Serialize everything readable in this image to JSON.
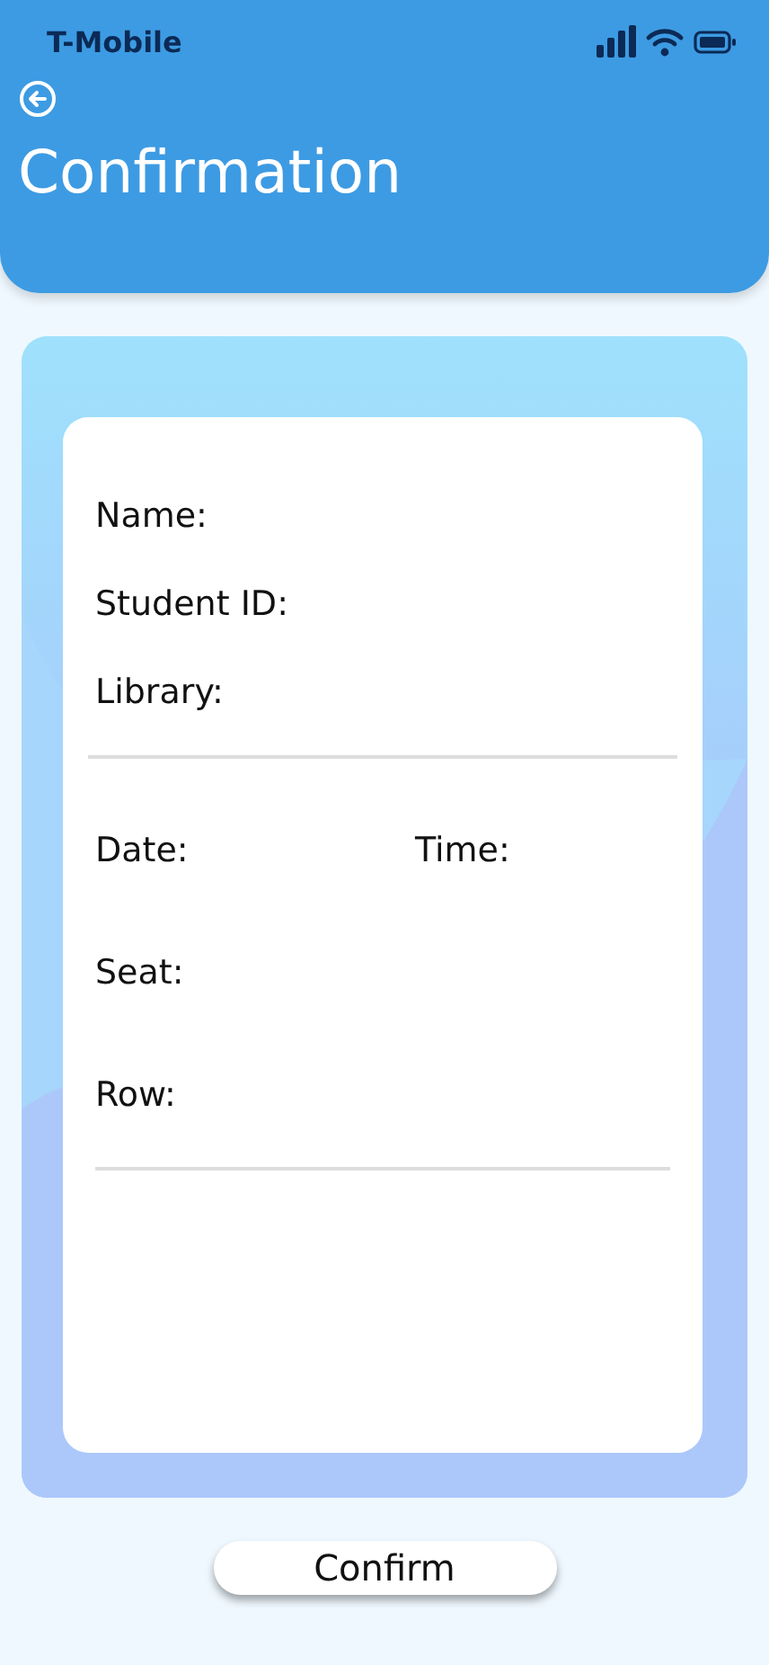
{
  "status_bar": {
    "carrier": "T-Mobile"
  },
  "header": {
    "title": "Confirmation"
  },
  "details": {
    "person": [
      {
        "label": "Name:"
      },
      {
        "label": "Student ID:"
      },
      {
        "label": "Library:"
      }
    ],
    "booking": [
      {
        "label": "Date:"
      },
      {
        "label": "Time:"
      },
      {
        "label": "Seat:"
      },
      {
        "label": "Row:"
      }
    ]
  },
  "confirm_button": {
    "label": "Confirm"
  }
}
